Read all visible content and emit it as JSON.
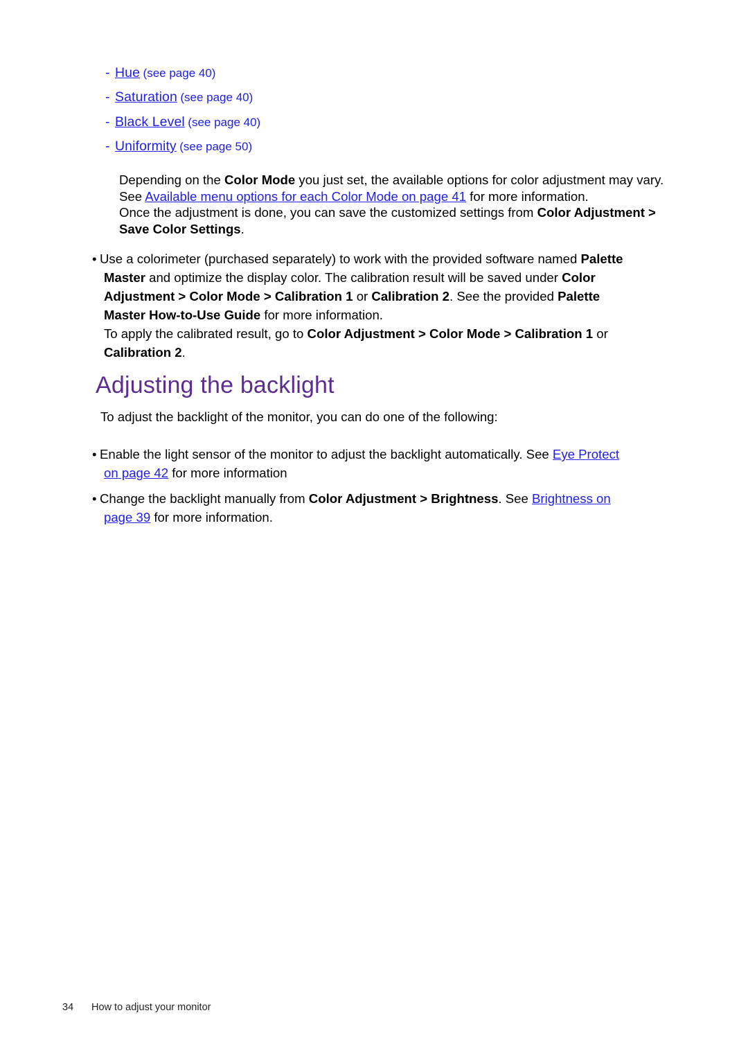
{
  "document": {
    "page_background": "#ffffff",
    "link_color": "#2020e6",
    "heading_color": "#5c2d91",
    "text_color": "#000000"
  },
  "sublist": {
    "dash": "-",
    "items": [
      {
        "link": "Hue",
        "ref": "(see page 40)"
      },
      {
        "link": "Saturation",
        "ref": "(see page 40)"
      },
      {
        "link": "Black Level",
        "ref": "(see page 40)"
      },
      {
        "link": "Uniformity",
        "ref": "(see page 50)"
      }
    ]
  },
  "paragraph": {
    "line1_a": "Depending on the ",
    "line1_b": "Color Mode",
    "line1_c": " you just set, the available options for color adjustment may vary.",
    "line2_a": "See ",
    "line2_link": "Available menu options for each Color Mode on page 41",
    "line2_c": " for more information.",
    "line3_a": "Once the adjustment is done, you can save the customized settings from ",
    "line3_b": "Color Adjustment",
    "line3_c": " >",
    "line4_b": "Save Color Settings",
    "line4_c": "."
  },
  "bullet_colorimeter": {
    "marker": "•",
    "l1_a": "Use a colorimeter (purchased separately) to work with the provided software named ",
    "l1_b": "Palette",
    "l2_b1": "Master",
    "l2_a": " and optimize the display color. The calibration result will be saved under ",
    "l2_b2": "Color",
    "l3_b1": "Adjustment > Color Mode > Calibration 1",
    "l3_a1": " or ",
    "l3_b2": "Calibration 2",
    "l3_a2": ". See the provided ",
    "l3_b3": "Palette",
    "l4_b": "Master How-to-Use Guide",
    "l4_a": " for more information.",
    "l5_a1": "To apply the calibrated result, go to ",
    "l5_b1": "Color Adjustment > Color Mode > Calibration 1",
    "l5_a2": " or",
    "l6_b": "Calibration 2",
    "l6_a": "."
  },
  "heading": {
    "text": "Adjusting the backlight"
  },
  "intro": {
    "text": "To adjust the backlight of the monitor, you can do one of the following:"
  },
  "bullet_light_sensor": {
    "marker": "•",
    "l1_a": "Enable the light sensor of the monitor to adjust the backlight automatically. See ",
    "l1_link": "Eye Protect",
    "l2_link": "on page 42",
    "l2_a": " for more information"
  },
  "bullet_manual": {
    "marker": "•",
    "l1_a": "Change the backlight manually from ",
    "l1_b1": "Color Adjustment",
    "l1_a2": " > ",
    "l1_b2": "Brightness",
    "l1_a3": ". See ",
    "l1_link": "Brightness on",
    "l2_link": "page 39",
    "l2_a": " for more information."
  },
  "footer": {
    "page_number": "34",
    "section": "How to adjust your monitor"
  }
}
